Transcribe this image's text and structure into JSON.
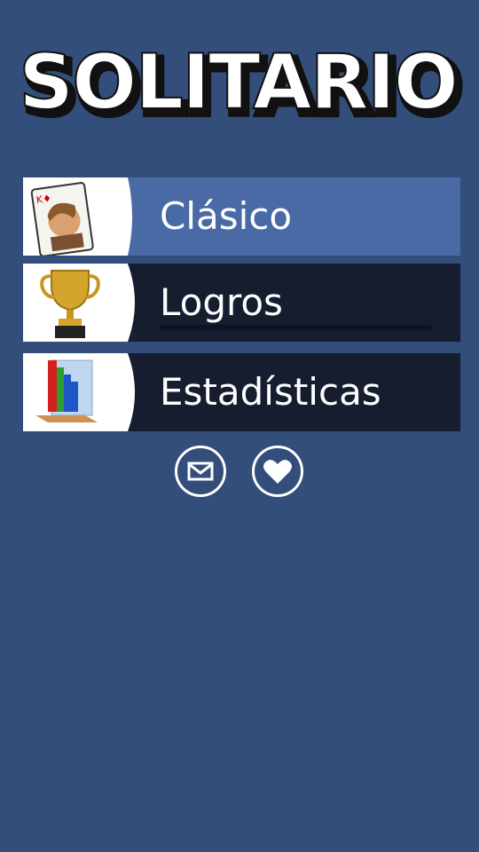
{
  "app": {
    "title": "SOLITARIO"
  },
  "menu": {
    "items": [
      {
        "label": "Clásico",
        "icon": "king-of-diamonds-card-icon",
        "card_rank": "K♦"
      },
      {
        "label": "Logros",
        "icon": "trophy-icon",
        "progress": 0
      },
      {
        "label": "Estadísticas",
        "icon": "bar-chart-icon"
      }
    ]
  },
  "footer": {
    "buttons": [
      {
        "icon": "mail-icon"
      },
      {
        "icon": "heart-icon"
      }
    ]
  },
  "colors": {
    "background": "#334e7a",
    "selected_item": "#4a6aa6",
    "item": "#151d2f",
    "text": "#ffffff"
  }
}
